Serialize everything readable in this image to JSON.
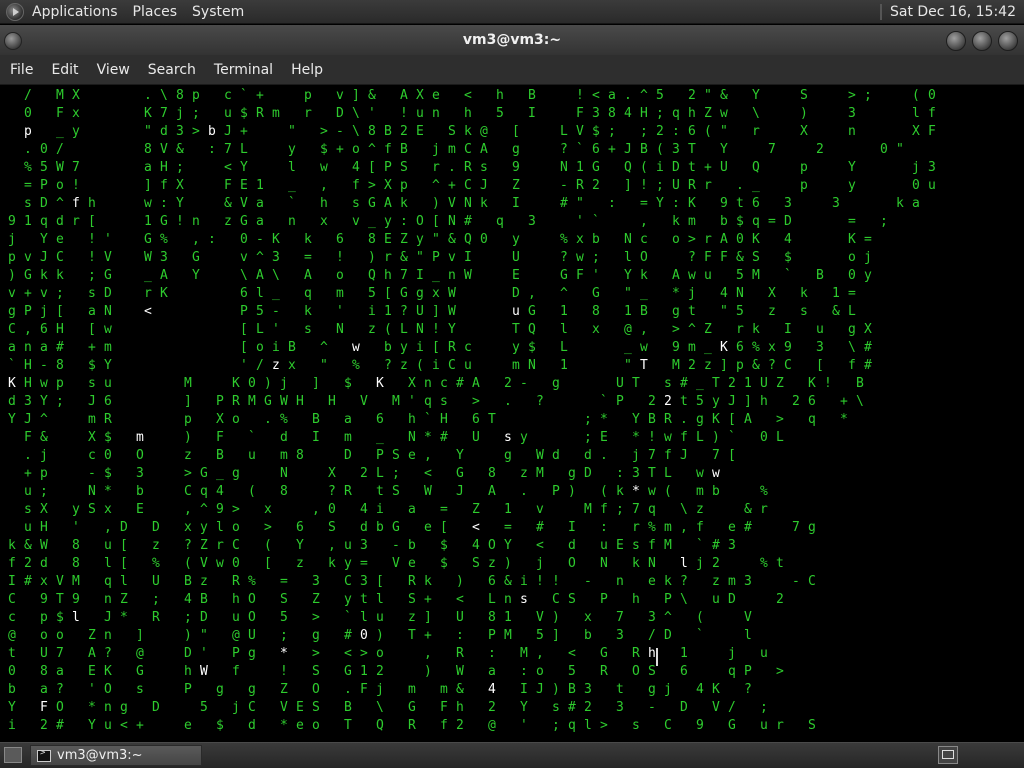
{
  "top_panel": {
    "menus": [
      "Applications",
      "Places",
      "System"
    ],
    "clock": "Sat Dec 16, 15:42"
  },
  "window": {
    "title": "vm3@vm3:~",
    "menus": [
      "File",
      "Edit",
      "View",
      "Search",
      "Terminal",
      "Help"
    ]
  },
  "terminal": {
    "fg_color": "#2ecc2e",
    "highlight_color": "#ffffff",
    "lines": [
      "   /   M X        . \\ 8 p   c ` +     p   v ] &   A X e   <   h   B     ! < a . ^ 5   2 \" &   Y     S     > ;     ( 0",
      "   0   F x        K 7 j ;   u $ R m   r   D \\ '   ! u n   h   5   I     F 3 8 4 H ; q h Z w   \\     )     3       l f",
      "   p   _ y        \" d 3 > b J +     \"   > - \\ 8 B 2 E   S k @   [     L V $ ;   ; 2 : 6 ( \"   r     X     n       X F",
      "   . 0 /          8 V &   : 7 L     y   $ + o ^ f B   j m C A   g     ? ` 6 + J B ( 3 T   Y     7     2       0 \"",
      "   % 5 W 7        a H ;     < Y     l   w   4 [ P S   r . R s   9     N 1 G   Q ( i D t + U   Q     p     Y       j 3",
      "   = P o !        ] f X     F E 1   _   ,   f > X p   ^ + C J   Z     - R 2   ] ! ; U R r   . _     p     y       0 u",
      "   s D ^ f h      w : Y     & V a   `   h   s G A k   ) V N k   I     # \"   :   = Y : K   9 t 6   3     3       k a",
      " 9 1 q d r [      1 G ! n   z G a   n   x   v _ y : O [ N #   q   3     ' `     ,   k m   b $ q = D       =   ;",
      " j   Y e   ! '    G %   , :   0 - K   k   6   8 E Z y \" & Q 0   y     % x b   N c   o > r A 0 K   4       K =",
      " p v J C   ! V    W 3   G     v ^ 3   =   !   ) r & \" P v I     U     ? w ;   l O     ? F F & S   $       o j",
      " ) G k k   ; G    _ A   Y     \\ A \\   A   o   Q h 7 I _ n W     E     G F '   Y k   A w u   5 M   `   B   0 y",
      " v + v ;   s D    r K         6 l _   q   m   5 [ G g x W       D ,   ^   G   \" _   * j   4 N   X   k   1 =",
      " g P j [   a N    <           P 5 -   k   '   i 1 ? U ] W       u G   1   8   1 B   g t   \" 5   z   s   & L",
      " C , 6 H   [ w                [ L '   s   N   z ( L N ! Y       T Q   l   x   @ ,   > ^ Z   r k   I   u   g X",
      " a n a #   + m                [ o i B   ^   w   b y i [ R c     y $   L       _ w   9 m _ K 6 % x 9   3   \\ #",
      " ` H - 8   $ Y                ' / z x   \"   %   ? z ( i C u     m N   1       \" T   M 2 z ] p & ? C   [   f #",
      " K H w p   s u         M     K 0 ) j   ]   $   K   X n c # A   2 -   g       U T   s # _ T 2 1 U Z   K !   B",
      " d 3 Y ;   J 6         ]   P R M G W H   H   V   M ' q s   >   .   ?       ` P   2 2 t 5 y J ] h   2 6   + \\",
      " Y J ^     m R         p   X o   . %   B   a   6   h ` H   6 T           ; *   Y B R . g K [ A   >   q   *",
      "   F &     X $   m     )   F   `   d   I   m   _   N * #   U   s y       ; E   * ! w f L ) `   0 L",
      "   . j     c 0   O     z   B   u   m 8     D   P S e ,   Y     g   W d   d .   j 7 f J   7 [",
      "   + p     - $   3     > G _ g     N     X   2 L ;   <   G   8   z M   g D   : 3 T L   w w",
      "   u ;     N *   b     C q 4   (   8     ? R   t S   W   J   A   .   P )   ( k * w (   m b     %",
      "   s X   y S x   E     , ^ 9 >   x     , 0   4 i   a   =   Z   1   v     M f ; 7 q   \\ z     & r",
      "   u H   '   , D   D   x y l o   >   6   S   d b G   e [   <   =   #   I   :   r % m , f   e #     7 g",
      " k & W   8   u [   z   ? Z r C   (   Y   , u 3   - b   $   4 O Y   <   d   u E s f M   ` # 3",
      " f 2 d   8   l [   %   ( V w 0   [   z   k y =   V e   $   S z )   j   O   N   k N   l j 2     % t",
      " I # x V M   q l   U   B z   R %   =   3   C 3 [   R k   )   6 & i ! !   -   n   e k ?   z m 3     - C",
      " C   9 T 9   n Z   ;   4 B   h O   S   Z   y t l   S +   <   L n s   C S   P   h   P \\   u D     2",
      " c   p $ l   J *   R   ; D   u O   5   >   ` l u   z ]   U   8 1   V )   x   7   3 ^   (     V",
      " @   o o   Z n   ]     ) \"   @ U   ;   g   # 0 )   T +   :   P M   5 ]   b   3   / D   `     l",
      " t   U 7   A ?   @     D '   P g   *   >   < > o     ,   R   :   M ,   <   G   R h   1     j   u",
      " 0   8 a   E K   G     h W   f     !   S   G 1 2     )   W   a   : o   5   R   O S   6     q P   >",
      " b   a ?   ' O   s     P   g   g   Z   O   . F j   m   m &   4   I J ) B 3   t   g j   4 K   ?",
      " Y   F O   * n g   D     5   j C   V E S   B   \\   G   F h   2   Y   s # 2   3   -   D   V /   ;",
      " i   2 #   Y u < +     e   $   d   * e o   T   Q   R   f 2   @   '   ; q l >   s   C   9   G   u r   S"
    ],
    "highlights": [
      "4",
      "b",
      "E",
      ":",
      "+",
      "o",
      "0",
      "K",
      "Y",
      "<",
      "I",
      "x",
      "m",
      "l",
      "P",
      "?",
      "q",
      "*",
      "2",
      "u",
      "z",
      "L",
      "M",
      "T",
      "W",
      "F",
      "J",
      "h",
      "p",
      "s",
      "f",
      "w",
      "y"
    ]
  },
  "taskbar": {
    "task_label": "vm3@vm3:~"
  }
}
